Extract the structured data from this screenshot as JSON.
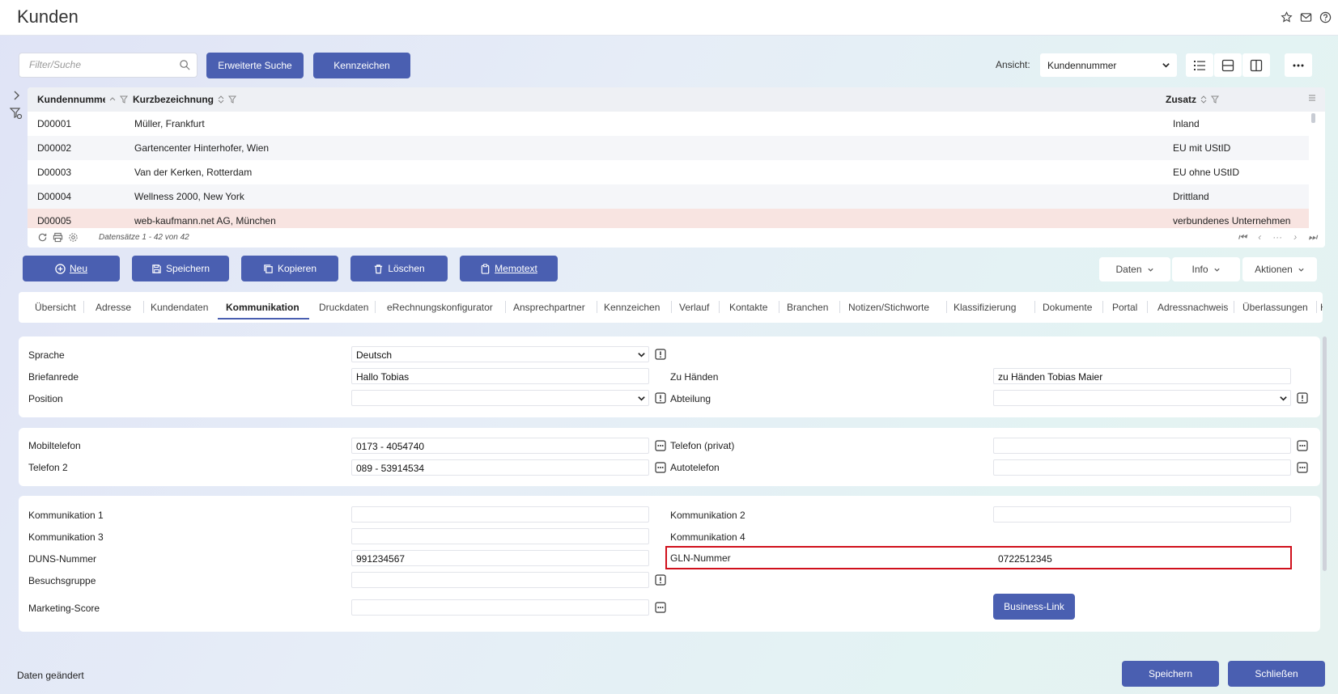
{
  "window": {
    "title": "Kunden"
  },
  "toolbar": {
    "search_placeholder": "Filter/Suche",
    "advanced_search": "Erweiterte Suche",
    "tags": "Kennzeichen",
    "view_label": "Ansicht:",
    "view_value": "Kundennummer"
  },
  "grid": {
    "columns": [
      "Kundennummer",
      "Kurzbezeichnung",
      "Zusatz"
    ],
    "rows": [
      {
        "nr": "D00001",
        "name": "Müller, Frankfurt",
        "zusatz": "Inland"
      },
      {
        "nr": "D00002",
        "name": "Gartencenter Hinterhofer, Wien",
        "zusatz": "EU mit UStID"
      },
      {
        "nr": "D00003",
        "name": "Van der Kerken, Rotterdam",
        "zusatz": "EU ohne UStID"
      },
      {
        "nr": "D00004",
        "name": "Wellness 2000, New York",
        "zusatz": "Drittland"
      },
      {
        "nr": "D00005",
        "name": "web-kaufmann.net AG, München",
        "zusatz": "verbundenes Unternehmen"
      }
    ],
    "record_count": "Datensätze 1 - 42 von 42"
  },
  "actions": {
    "new": "Neu",
    "save": "Speichern",
    "copy": "Kopieren",
    "delete": "Löschen",
    "memo": "Memotext",
    "data": "Daten",
    "info": "Info",
    "more": "Aktionen"
  },
  "tabs": [
    "Übersicht",
    "Adresse",
    "Kundendaten",
    "Kommunikation",
    "Druckdaten",
    "eRechnungskonfigurator",
    "Ansprechpartner",
    "Kennzeichen",
    "Verlauf",
    "Kontakte",
    "Branchen",
    "Notizen/Stichworte",
    "Klassifizierung",
    "Dokumente",
    "Portal",
    "Adressnachweis",
    "Überlassungen",
    "Hi"
  ],
  "form": {
    "sprache": {
      "label": "Sprache",
      "value": "Deutsch"
    },
    "briefanrede": {
      "label": "Briefanrede",
      "value": "Hallo Tobias"
    },
    "zu_haenden": {
      "label": "Zu Händen",
      "value": "zu Händen Tobias Maier"
    },
    "position": {
      "label": "Position",
      "value": ""
    },
    "abteilung": {
      "label": "Abteilung",
      "value": ""
    },
    "mobiltelefon": {
      "label": "Mobiltelefon",
      "value": "0173 - 4054740"
    },
    "telefon_privat": {
      "label": "Telefon (privat)",
      "value": ""
    },
    "telefon2": {
      "label": "Telefon 2",
      "value": "089 - 53914534"
    },
    "autotelefon": {
      "label": "Autotelefon",
      "value": ""
    },
    "komm1": {
      "label": "Kommunikation 1",
      "value": ""
    },
    "komm2": {
      "label": "Kommunikation 2",
      "value": ""
    },
    "komm3": {
      "label": "Kommunikation 3",
      "value": ""
    },
    "komm4": {
      "label": "Kommunikation 4",
      "value": ""
    },
    "duns": {
      "label": "DUNS-Nummer",
      "value": "991234567"
    },
    "gln": {
      "label": "GLN-Nummer",
      "value": "0722512345"
    },
    "besuchsgruppe": {
      "label": "Besuchsgruppe",
      "value": ""
    },
    "marketing": {
      "label": "Marketing-Score",
      "value": ""
    },
    "business_link": "Business-Link"
  },
  "footer": {
    "status": "Daten geändert",
    "save": "Speichern",
    "close": "Schließen"
  },
  "colors": {
    "accent": "#4a5fb1",
    "selected_row": "#f8e4e1",
    "highlight": "#d0101c"
  }
}
